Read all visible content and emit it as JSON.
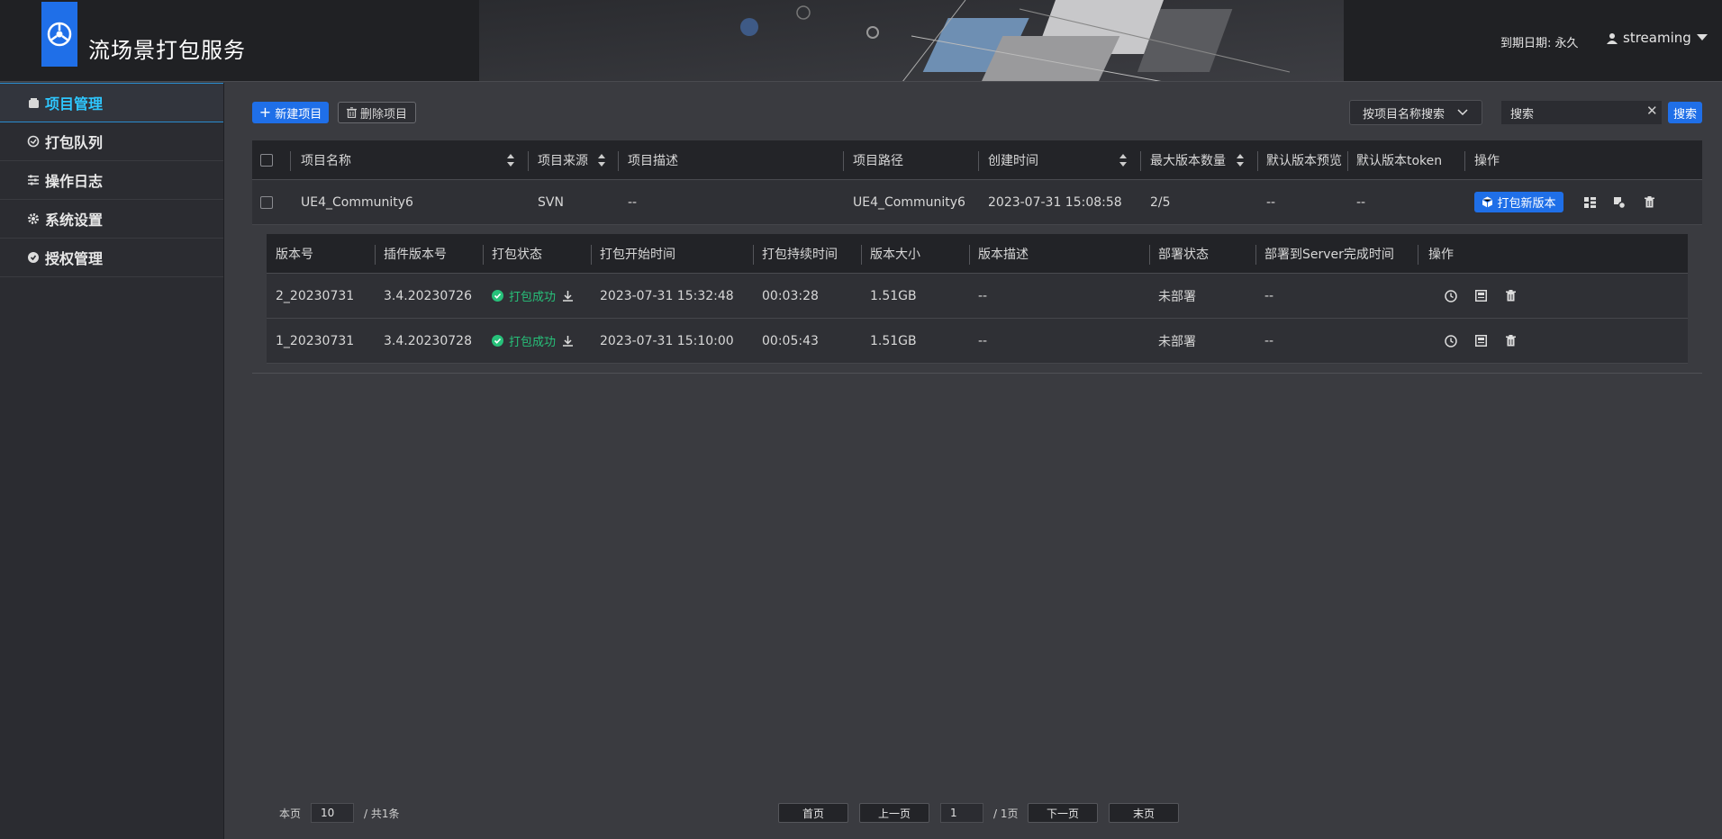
{
  "header": {
    "app_title": "流场景打包服务",
    "expire_label": "到期日期:",
    "expire_value": "永久",
    "username": "streaming"
  },
  "sidebar": {
    "items": [
      {
        "label": "项目管理",
        "icon": "box-icon",
        "active": true
      },
      {
        "label": "打包队列",
        "icon": "refresh-icon"
      },
      {
        "label": "操作日志",
        "icon": "sliders-icon"
      },
      {
        "label": "系统设置",
        "icon": "gear-icon"
      },
      {
        "label": "授权管理",
        "icon": "shield-icon"
      }
    ]
  },
  "toolbar": {
    "new_project": "新建项目",
    "delete_project": "删除项目",
    "search_mode": "按项目名称搜索",
    "search_value": "搜索",
    "search_button": "搜索"
  },
  "project_table": {
    "columns": [
      "项目名称",
      "项目来源",
      "项目描述",
      "项目路径",
      "创建时间",
      "最大版本数量",
      "默认版本预览",
      "默认版本token",
      "操作"
    ],
    "rows": [
      {
        "name": "UE4_Community6",
        "source": "SVN",
        "desc": "--",
        "path": "UE4_Community6",
        "created": "2023-07-31 15:08:58",
        "max_versions": "2/5",
        "preview": "--",
        "token": "--",
        "pack_button": "打包新版本"
      }
    ]
  },
  "version_table": {
    "columns": [
      "版本号",
      "插件版本号",
      "打包状态",
      "打包开始时间",
      "打包持续时间",
      "版本大小",
      "版本描述",
      "部署状态",
      "部署到Server完成时间",
      "操作"
    ],
    "rows": [
      {
        "version": "2_20230731",
        "plugin": "3.4.20230726",
        "status": "打包成功",
        "start": "2023-07-31 15:32:48",
        "duration": "00:03:28",
        "size": "1.51GB",
        "desc": "--",
        "deploy": "未部署",
        "deploy_time": "--"
      },
      {
        "version": "1_20230731",
        "plugin": "3.4.20230728",
        "status": "打包成功",
        "start": "2023-07-31 15:10:00",
        "duration": "00:05:43",
        "size": "1.51GB",
        "desc": "--",
        "deploy": "未部署",
        "deploy_time": "--"
      }
    ]
  },
  "pagination": {
    "per_page_label": "本页",
    "per_page_value": "10",
    "total_label": "/ 共1条",
    "first": "首页",
    "prev": "上一页",
    "page_value": "1",
    "page_total": "/ 1页",
    "next": "下一页",
    "last": "末页"
  },
  "colors": {
    "accent": "#1f6fe8",
    "active_nav": "#2ec7ff",
    "success": "#27c17a"
  }
}
